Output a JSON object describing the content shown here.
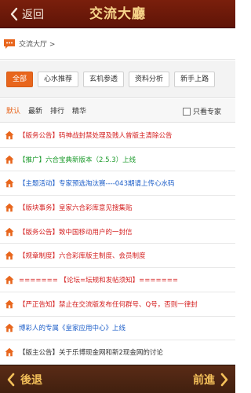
{
  "header": {
    "back_label": "返回",
    "title": "交流大廳"
  },
  "breadcrumb": {
    "text": "交流大厅 >"
  },
  "filters": [
    {
      "label": "全部",
      "active": true
    },
    {
      "label": "心水推荐",
      "active": false
    },
    {
      "label": "玄机参透",
      "active": false
    },
    {
      "label": "资料分析",
      "active": false
    },
    {
      "label": "新手上路",
      "active": false
    }
  ],
  "sort": {
    "tabs": [
      {
        "label": "默认",
        "active": true
      },
      {
        "label": "最新",
        "active": false
      },
      {
        "label": "排行",
        "active": false
      },
      {
        "label": "精华",
        "active": false
      }
    ],
    "expert_label": "只看专家"
  },
  "posts": [
    {
      "title": "【版务公告】码神战封禁处理及贱人曾版主清除公告",
      "color": "#d42020"
    },
    {
      "title": "【推广】六合宝典新版本（2.5.3）上线",
      "color": "#1a9a2a"
    },
    {
      "title": "【主题活动】专家预选淘汰赛----043期请上传心水码",
      "color": "#1e5fc9"
    },
    {
      "title": "【版块事务】皇家六合彩库意见搜集贴",
      "color": "#d42020"
    },
    {
      "title": "【版务公告】致中国移动用户的一封信",
      "color": "#d42020"
    },
    {
      "title": "【规章制度】六合彩库版主制度、会员制度",
      "color": "#d42020"
    },
    {
      "title": "======= 【论坛=坛规和发帖须知】=======",
      "color": "#d42020"
    },
    {
      "title": "【严正告知】禁止在交流版发布任何群号、Q号，否则一律封",
      "color": "#d42020"
    },
    {
      "title": "博彩人的专属《皇家应用中心》上线",
      "color": "#1e5fc9"
    },
    {
      "title": "【版主公告】关于乐博现金网和新2现金网的讨论",
      "color": "#333333"
    }
  ],
  "footer": {
    "prev_label": "後退",
    "next_label": "前進"
  },
  "colors": {
    "header_bg": "#6b1a09",
    "title_gold": "#f7d48a",
    "accent_orange": "#e8661d",
    "footer_bg": "#4c2512",
    "footer_text": "#f5c15a"
  },
  "icons": {
    "back": "chevron-left-icon",
    "chat": "chat-bubble-icon",
    "post": "home-icon",
    "prev": "chevron-left-icon",
    "next": "chevron-right-icon"
  }
}
